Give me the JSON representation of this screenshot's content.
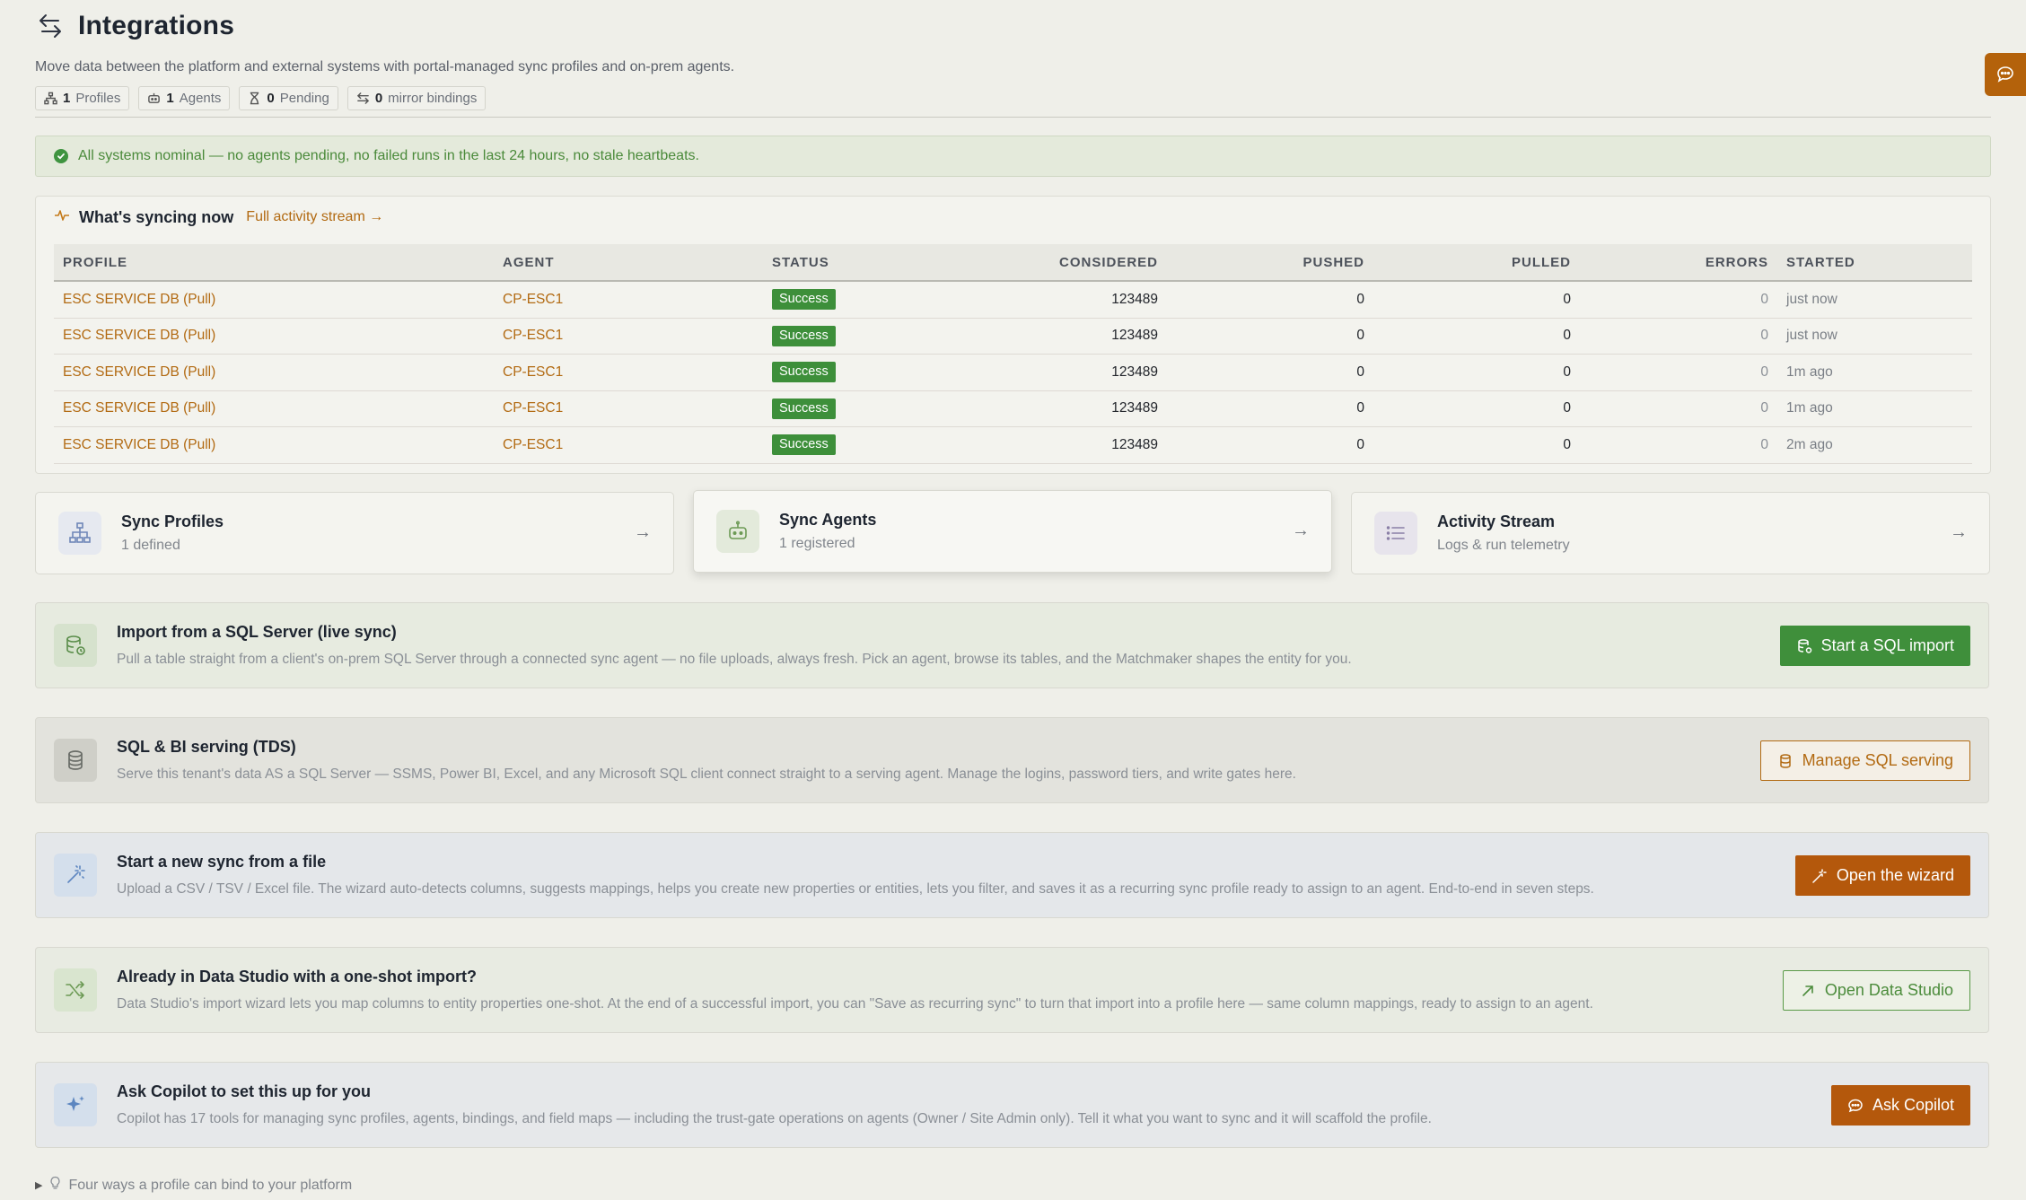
{
  "header": {
    "title": "Integrations",
    "subtitle": "Move data between the platform and external systems with portal-managed sync profiles and on-prem agents.",
    "chips": [
      {
        "icon": "hierarchy-icon",
        "count": "1",
        "label": "Profiles"
      },
      {
        "icon": "robot-icon",
        "count": "1",
        "label": "Agents"
      },
      {
        "icon": "hourglass-icon",
        "count": "0",
        "label": "Pending"
      },
      {
        "icon": "swap-arrows-icon",
        "count": "0",
        "label": "mirror bindings"
      }
    ]
  },
  "status_banner": {
    "text": "All systems nominal — no agents pending, no failed runs in the last 24 hours, no stale heartbeats."
  },
  "activity": {
    "title": "What's syncing now",
    "link": "Full activity stream →",
    "columns": [
      "PROFILE",
      "AGENT",
      "STATUS",
      "CONSIDERED",
      "PUSHED",
      "PULLED",
      "ERRORS",
      "STARTED"
    ],
    "rows": [
      {
        "profile": "ESC SERVICE DB (Pull)",
        "agent": "CP-ESC1",
        "status": "Success",
        "considered": "123489",
        "pushed": "0",
        "pulled": "0",
        "errors": "0",
        "started": "just now"
      },
      {
        "profile": "ESC SERVICE DB (Pull)",
        "agent": "CP-ESC1",
        "status": "Success",
        "considered": "123489",
        "pushed": "0",
        "pulled": "0",
        "errors": "0",
        "started": "just now"
      },
      {
        "profile": "ESC SERVICE DB (Pull)",
        "agent": "CP-ESC1",
        "status": "Success",
        "considered": "123489",
        "pushed": "0",
        "pulled": "0",
        "errors": "0",
        "started": "1m ago"
      },
      {
        "profile": "ESC SERVICE DB (Pull)",
        "agent": "CP-ESC1",
        "status": "Success",
        "considered": "123489",
        "pushed": "0",
        "pulled": "0",
        "errors": "0",
        "started": "1m ago"
      },
      {
        "profile": "ESC SERVICE DB (Pull)",
        "agent": "CP-ESC1",
        "status": "Success",
        "considered": "123489",
        "pushed": "0",
        "pulled": "0",
        "errors": "0",
        "started": "2m ago"
      }
    ]
  },
  "cards": [
    {
      "title": "Sync Profiles",
      "sub": "1 defined",
      "icon": "hierarchy-icon",
      "arrow": "→"
    },
    {
      "title": "Sync Agents",
      "sub": "1 registered",
      "icon": "robot-icon",
      "arrow": "→"
    },
    {
      "title": "Activity Stream",
      "sub": "Logs & run telemetry",
      "icon": "list-icon",
      "arrow": "→"
    }
  ],
  "panels": [
    {
      "title": "Import from a SQL Server (live sync)",
      "desc": "Pull a table straight from a client's on-prem SQL Server through a connected sync agent — no file uploads, always fresh. Pick an agent, browse its tables, and the Matchmaker shapes the entity for you.",
      "button": "Start a SQL import",
      "icon": "database-sync-icon"
    },
    {
      "title": "SQL & BI serving (TDS)",
      "desc": "Serve this tenant's data AS a SQL Server — SSMS, Power BI, Excel, and any Microsoft SQL client connect straight to a serving agent. Manage the logins, password tiers, and write gates here.",
      "button": "Manage SQL serving",
      "icon": "database-icon"
    },
    {
      "title": "Start a new sync from a file",
      "desc": "Upload a CSV / TSV / Excel file. The wizard auto-detects columns, suggests mappings, helps you create new properties or entities, lets you filter, and saves it as a recurring sync profile ready to assign to an agent. End-to-end in seven steps.",
      "button": "Open the wizard",
      "icon": "magic-wand-icon"
    },
    {
      "title": "Already in Data Studio with a one-shot import?",
      "desc": "Data Studio's import wizard lets you map columns to entity properties one-shot. At the end of a successful import, you can \"Save as recurring sync\" to turn that import into a profile here — same column mappings, ready to assign to an agent.",
      "button": "Open Data Studio",
      "icon": "shuffle-icon"
    },
    {
      "title": "Ask Copilot to set this up for you",
      "desc": "Copilot has 17 tools for managing sync profiles, agents, bindings, and field maps — including the trust-gate operations on agents (Owner / Site Admin only). Tell it what you want to sync and it will scaffold the profile.",
      "button": "Ask Copilot",
      "icon": "sparkles-icon"
    }
  ],
  "footer_hint": "Four ways a profile can bind to your platform",
  "colors": {
    "accent": "#b26a12",
    "success": "#3d8f3a",
    "orange_button": "#b4580c",
    "green_button": "#3f8f3b"
  }
}
